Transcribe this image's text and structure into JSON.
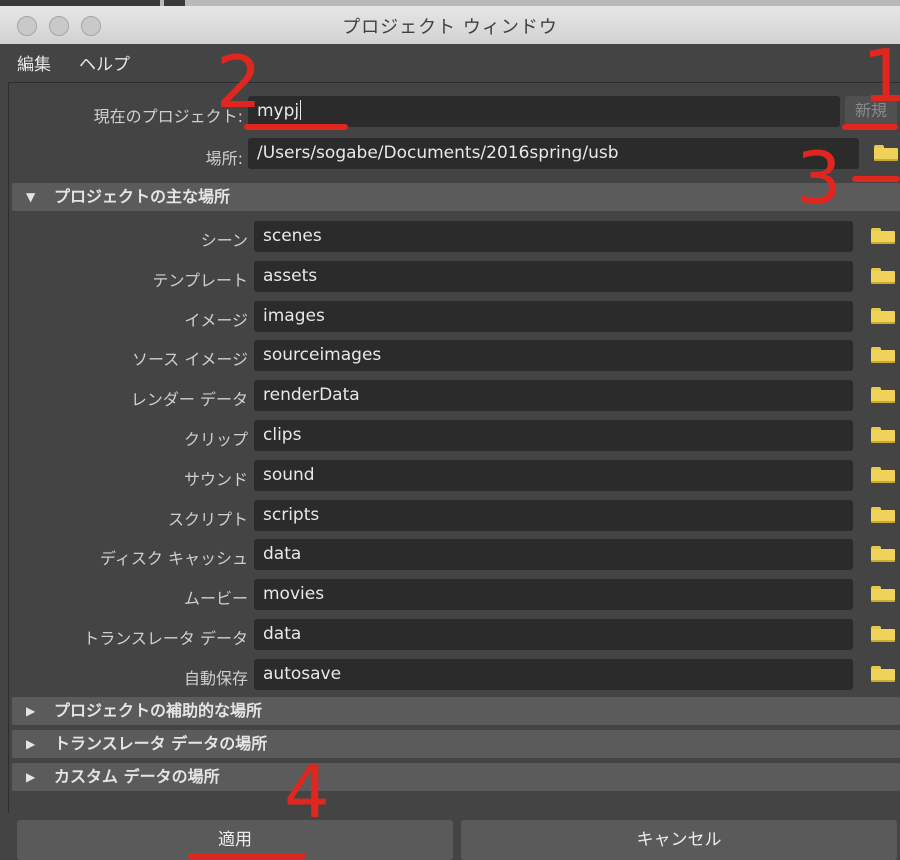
{
  "window": {
    "title": "プロジェクト ウィンドウ"
  },
  "menu": {
    "items": [
      "編集",
      "ヘルプ"
    ]
  },
  "project": {
    "current_label": "現在のプロジェクト:",
    "current_value": "mypj",
    "new_button": "新規",
    "location_label": "場所:",
    "location_value": "/Users/sogabe/Documents/2016spring/usb"
  },
  "sections": {
    "primary": "プロジェクトの主な場所",
    "secondary": "プロジェクトの補助的な場所",
    "translator": "トランスレータ データの場所",
    "custom": "カスタム データの場所"
  },
  "locations": [
    {
      "label": "シーン",
      "value": "scenes"
    },
    {
      "label": "テンプレート",
      "value": "assets"
    },
    {
      "label": "イメージ",
      "value": "images"
    },
    {
      "label": "ソース イメージ",
      "value": "sourceimages"
    },
    {
      "label": "レンダー データ",
      "value": "renderData"
    },
    {
      "label": "クリップ",
      "value": "clips"
    },
    {
      "label": "サウンド",
      "value": "sound"
    },
    {
      "label": "スクリプト",
      "value": "scripts"
    },
    {
      "label": "ディスク キャッシュ",
      "value": "data"
    },
    {
      "label": "ムービー",
      "value": "movies"
    },
    {
      "label": "トランスレータ データ",
      "value": "data"
    },
    {
      "label": "自動保存",
      "value": "autosave"
    }
  ],
  "buttons": {
    "apply": "適用",
    "cancel": "キャンセル"
  },
  "annotations": {
    "n1": "1",
    "n2": "2",
    "n3": "3",
    "n4": "4",
    "color": "#e0261f"
  },
  "icons": {
    "folder": "folder-icon",
    "expanded": "triangle-down-icon",
    "collapsed": "triangle-right-icon"
  }
}
